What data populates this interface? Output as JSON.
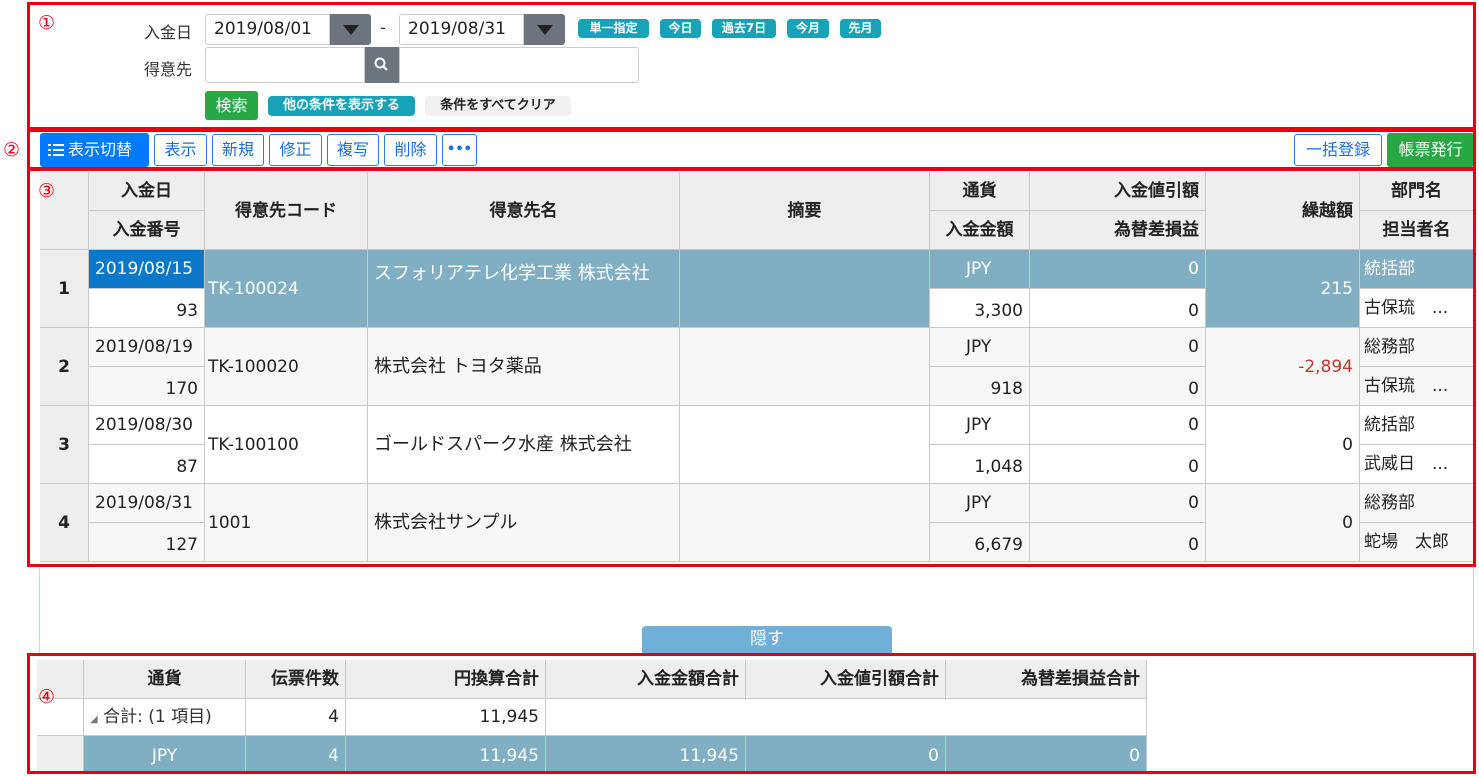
{
  "markers": [
    "①",
    "②",
    "③",
    "④"
  ],
  "search": {
    "date_label": "入金日",
    "date_from": "2019/08/01",
    "date_sep": "-",
    "date_to": "2019/08/31",
    "quick": [
      "単一指定",
      "今日",
      "過去7日",
      "今月",
      "先月"
    ],
    "customer_label": "得意先",
    "customer_value": "",
    "search_btn": "検索",
    "more_btn": "他の条件を表示する",
    "clear_btn": "条件をすべてクリア"
  },
  "toolbar": {
    "toggle": "表示切替",
    "buttons": [
      "表示",
      "新規",
      "修正",
      "複写",
      "削除",
      "•••"
    ],
    "bulk": "一括登録",
    "issue": "帳票発行"
  },
  "grid": {
    "headers": {
      "date": "入金日",
      "number": "入金番号",
      "code": "得意先コード",
      "name": "得意先名",
      "memo": "摘要",
      "currency": "通貨",
      "amount": "入金金額",
      "discount": "入金値引額",
      "fx": "為替差損益",
      "carry": "繰越額",
      "dept": "部門名",
      "staff": "担当者名"
    },
    "rows": [
      {
        "no": "1",
        "date": "2019/08/15",
        "number": "93",
        "code": "TK-100024",
        "name": "スフォリアテレ化学工業 株式会社",
        "memo": "",
        "currency": "JPY",
        "amount": "3,300",
        "discount": "0",
        "fx": "0",
        "carry": "215",
        "dept": "統括部",
        "staff": "古保琉　..."
      },
      {
        "no": "2",
        "date": "2019/08/19",
        "number": "170",
        "code": "TK-100020",
        "name": "株式会社 トヨタ薬品",
        "memo": "",
        "currency": "JPY",
        "amount": "918",
        "discount": "0",
        "fx": "0",
        "carry": "-2,894",
        "dept": "総務部",
        "staff": "古保琉　..."
      },
      {
        "no": "3",
        "date": "2019/08/30",
        "number": "87",
        "code": "TK-100100",
        "name": "ゴールドスパーク水産 株式会社",
        "memo": "",
        "currency": "JPY",
        "amount": "1,048",
        "discount": "0",
        "fx": "0",
        "carry": "0",
        "dept": "統括部",
        "staff": "武威日　..."
      },
      {
        "no": "4",
        "date": "2019/08/31",
        "number": "127",
        "code": "1001",
        "name": "株式会社サンプル",
        "memo": "",
        "currency": "JPY",
        "amount": "6,679",
        "discount": "0",
        "fx": "0",
        "carry": "0",
        "dept": "総務部",
        "staff": "蛇場　太郎"
      }
    ]
  },
  "hide_btn": "隠す",
  "summary": {
    "headers": [
      "通貨",
      "伝票件数",
      "円換算合計",
      "入金金額合計",
      "入金値引額合計",
      "為替差損益合計"
    ],
    "group_row": {
      "label": "合計: (1 項目)",
      "count": "4",
      "yen": "11,945"
    },
    "row": {
      "currency": "JPY",
      "count": "4",
      "yen": "11,945",
      "amount": "11,945",
      "discount": "0",
      "fx": "0"
    }
  },
  "colors": {
    "accent": "#007bff",
    "badge": "#17a2b8",
    "success": "#28a745",
    "selected": "#80afc4",
    "negative": "#c0392b",
    "marker": "#e60012"
  }
}
